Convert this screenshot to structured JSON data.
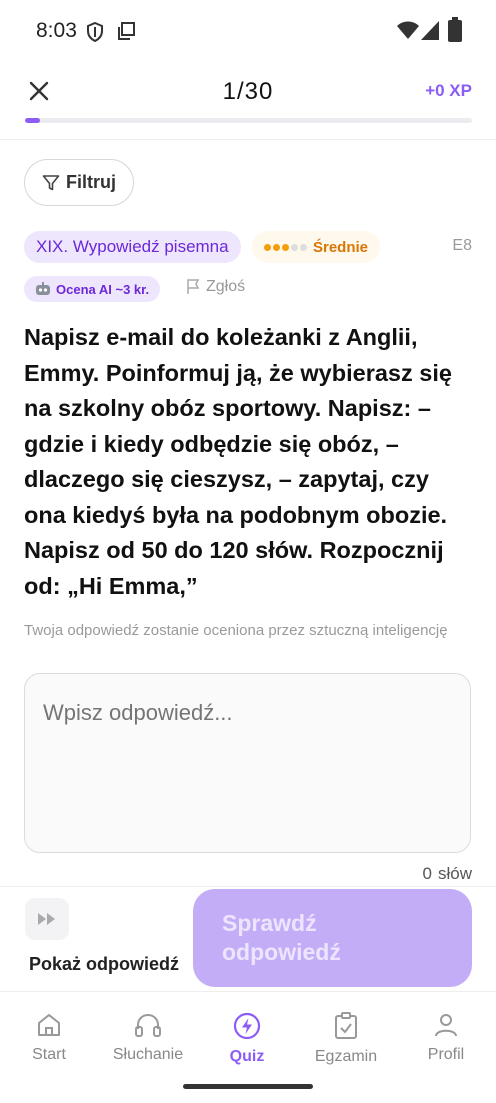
{
  "status_bar": {
    "time": "8:03"
  },
  "header": {
    "counter": "1/30",
    "xp": "+0 XP",
    "progress_fraction": 0.0333
  },
  "filter": {
    "label": "Filtruj"
  },
  "question_meta": {
    "category": "XIX. Wypowiedź pisemna",
    "difficulty": "Średnie",
    "code": "E8",
    "ai_badge": "Ocena AI ~3 kr.",
    "report_label": "Zgłoś"
  },
  "question": {
    "text": "Napisz e-mail do koleżanki z Anglii, Emmy. Poinformuj ją, że wybierasz się na szkolny obóz sportowy. Napisz: – gdzie i kiedy odbędzie się obóz, – dlaczego się cieszysz, – zapytaj, czy ona kiedyś była na podobnym obozie. Napisz od 50 do 120 słów. Rozpocznij od: „Hi Emma,”"
  },
  "answer": {
    "hint": "Twoja odpowiedź zostanie oceniona przez sztuczną inteligencję",
    "placeholder": "Wpisz odpowiedź...",
    "value": "",
    "word_count": "0",
    "word_label": "słów"
  },
  "actions": {
    "show_answer": "Pokaż odpowiedź",
    "check_answer": "Sprawdź odpowiedź"
  },
  "nav": {
    "items": [
      {
        "label": "Start",
        "icon": "home-icon"
      },
      {
        "label": "Słuchanie",
        "icon": "headphones-icon"
      },
      {
        "label": "Quiz",
        "icon": "lightning-icon"
      },
      {
        "label": "Egzamin",
        "icon": "clipboard-check-icon"
      },
      {
        "label": "Profil",
        "icon": "person-icon"
      }
    ],
    "active": "Quiz"
  },
  "colors": {
    "accent": "#8b5cf6",
    "difficulty": "#d97706",
    "tag_bg": "#ede6fd"
  }
}
